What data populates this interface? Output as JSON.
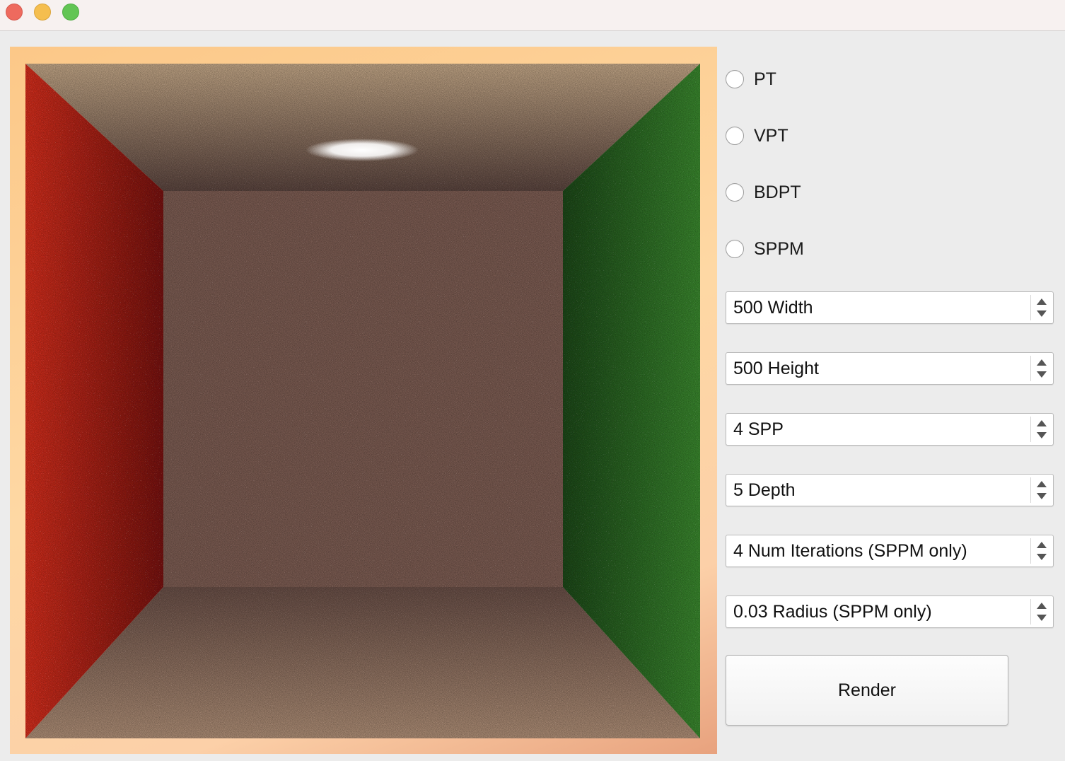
{
  "window": {
    "traffic_lights": [
      "close",
      "minimize",
      "maximize"
    ]
  },
  "viewport": {
    "image": "cornell-box-render",
    "frame_colors": [
      "#fcc888",
      "#fed8a4",
      "#e8a27e"
    ],
    "scene_colors": {
      "left_wall": "#c2281c",
      "right_wall": "#2f7a28",
      "back_wall": "#7a5a50",
      "ceiling": "#a48a74",
      "floor": "#8e7262",
      "light": "#ffffff"
    }
  },
  "integrators": [
    {
      "label": "PT",
      "selected": false
    },
    {
      "label": "VPT",
      "selected": false
    },
    {
      "label": "BDPT",
      "selected": false
    },
    {
      "label": "SPPM",
      "selected": false
    }
  ],
  "settings": [
    {
      "value": "500",
      "label": "Width",
      "display": "500 Width"
    },
    {
      "value": "500",
      "label": "Height",
      "display": "500 Height"
    },
    {
      "value": "4",
      "label": "SPP",
      "display": "4 SPP"
    },
    {
      "value": "5",
      "label": "Depth",
      "display": "5 Depth"
    },
    {
      "value": "4",
      "label": "Num Iterations (SPPM only)",
      "display": "4 Num Iterations (SPPM only)"
    },
    {
      "value": "0.03",
      "label": "Radius (SPPM only)",
      "display": "0.03 Radius (SPPM only)"
    }
  ],
  "actions": {
    "render_label": "Render"
  },
  "icons": {
    "spin_up": "chevron-up-icon",
    "spin_down": "chevron-down-icon"
  }
}
